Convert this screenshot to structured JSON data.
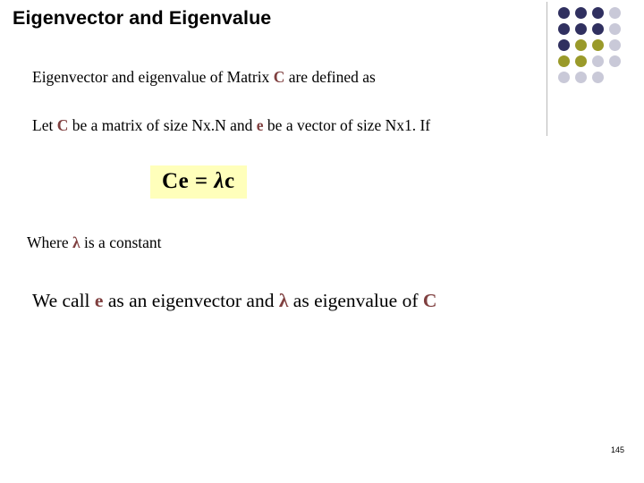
{
  "slide": {
    "title": "Eigenvector and Eigenvalue",
    "page_number": "145",
    "background_color": "#ffffff"
  },
  "content": {
    "line1_prefix": "Eigenvector and eigenvalue of Matrix ",
    "line1_var": "C",
    "line1_suffix": " are defined as",
    "line2_prefix": "Let ",
    "line2_var1": "C",
    "line2_mid": " be a matrix of size Nx.N and ",
    "line2_var2": "e",
    "line2_suffix": " be a vector of size Nx1. If",
    "equation_c": "C",
    "equation_e": "e",
    "equation_eq": " = ",
    "equation_lambda": "λ",
    "equation_e2": "c",
    "line3_prefix": "Where ",
    "line3_lambda": "λ",
    "line3_suffix": " is a constant",
    "line4_prefix": "We call ",
    "line4_var1": "e",
    "line4_mid": " as an eigenvector and ",
    "line4_lambda": "λ",
    "line4_mid2": " as eigenvalue of ",
    "line4_var2": "C"
  },
  "decoration": {
    "accent_dark": "#303060",
    "accent_olive": "#9a9a2a",
    "accent_light": "#c9c9d8",
    "divider_color": "#b9b9b9",
    "highlight_color": "#ffffbb",
    "variable_color": "#7f3f3f",
    "dot_rows": [
      [
        "#303060",
        "#303060",
        "#303060",
        "#c9c9d8"
      ],
      [
        "#303060",
        "#303060",
        "#303060",
        "#c9c9d8"
      ],
      [
        "#303060",
        "#9a9a2a",
        "#9a9a2a",
        "#c9c9d8"
      ],
      [
        "#9a9a2a",
        "#9a9a2a",
        "#c9c9d8",
        "#c9c9d8"
      ],
      [
        "#c9c9d8",
        "#c9c9d8",
        "#c9c9d8",
        "#ffffff"
      ]
    ]
  }
}
